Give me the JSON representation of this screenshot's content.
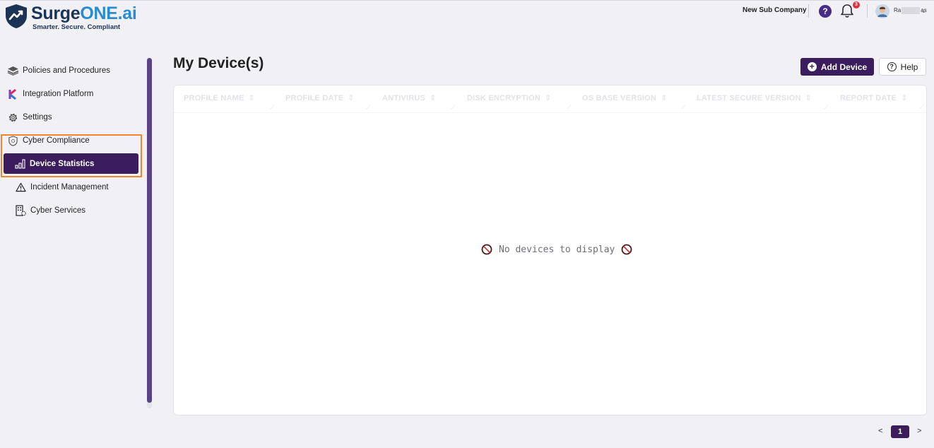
{
  "brand": {
    "name_part1": "Surge",
    "name_part2": "ONE.ai",
    "tagline": "Smarter. Secure. Compliant"
  },
  "header": {
    "company": "New Sub Company",
    "help_glyph": "?",
    "notifications_count": "3",
    "user_initial": "Ra",
    "user_suffix": "as",
    "user_chevron": "⌄"
  },
  "sidebar": {
    "items": [
      {
        "label": "Policies and Procedures",
        "icon": "layers-icon"
      },
      {
        "label": "Integration Platform",
        "icon": "k-logo-icon"
      },
      {
        "label": "Settings",
        "icon": "gear-icon"
      },
      {
        "label": "Cyber Compliance",
        "icon": "shield-gear-icon"
      },
      {
        "label": "Device Statistics",
        "icon": "bar-chart-icon",
        "active": true
      },
      {
        "label": "Incident Management",
        "icon": "warning-icon"
      },
      {
        "label": "Cyber Services",
        "icon": "building-gear-icon"
      }
    ]
  },
  "main": {
    "title": "My Device(s)",
    "add_button": "Add Device",
    "help_button": "Help",
    "columns": [
      "PROFILE NAME",
      "PROFILE DATE",
      "ANTIVIRUS",
      "DISK ENCRYPTION",
      "OS BASE VERSION",
      "LATEST SECURE VERSION",
      "REPORT DATE"
    ],
    "sort_glyph": "⇕",
    "empty_message": "No devices to display"
  },
  "pagination": {
    "prev": "<",
    "current": "1",
    "next": ">"
  },
  "colors": {
    "primary": "#3b1c5c",
    "highlight": "#f0852c",
    "badge": "#e0303b",
    "background": "#f1f1f5"
  }
}
